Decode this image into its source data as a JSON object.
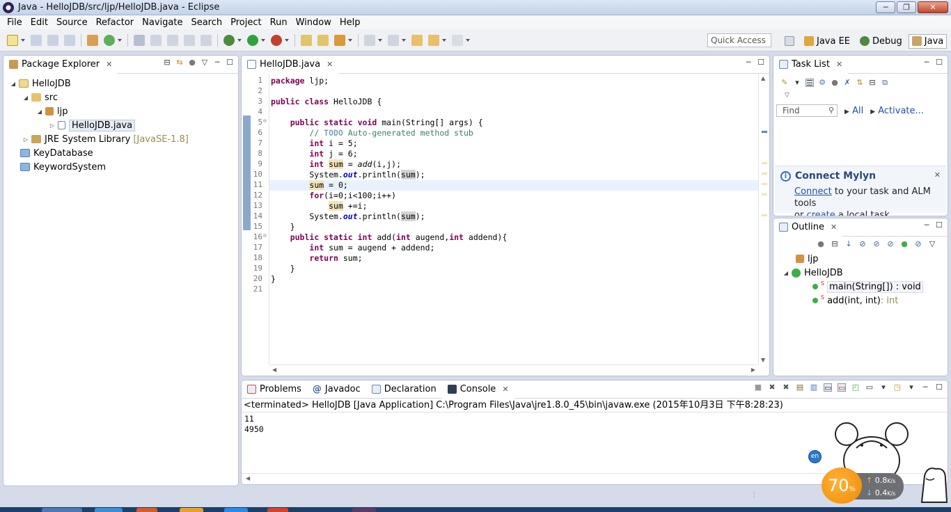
{
  "window": {
    "title": "Java - HelloJDB/src/ljp/HelloJDB.java - Eclipse",
    "min": "0",
    "max": "1",
    "close": "r"
  },
  "menu": [
    "File",
    "Edit",
    "Source",
    "Refactor",
    "Navigate",
    "Search",
    "Project",
    "Run",
    "Window",
    "Help"
  ],
  "toolbar": {
    "quick_access": "Quick Access"
  },
  "perspectives": [
    "Java EE",
    "Debug",
    "Java"
  ],
  "package_explorer": {
    "tab": "Package Explorer",
    "items": [
      {
        "label": "HelloJDB",
        "suffix": ""
      },
      {
        "label": "src",
        "suffix": ""
      },
      {
        "label": "ljp",
        "suffix": ""
      },
      {
        "label": "HelloJDB.java",
        "suffix": ""
      },
      {
        "label": "JRE System Library",
        "suffix": "[JavaSE-1.8]"
      },
      {
        "label": "KeyDatabase",
        "suffix": ""
      },
      {
        "label": "KeywordSystem",
        "suffix": ""
      }
    ]
  },
  "editor": {
    "tab": "HelloJDB.java",
    "line_numbers": [
      "1",
      "2",
      "3",
      "4",
      "5",
      "6",
      "7",
      "8",
      "9",
      "10",
      "11",
      "12",
      "13",
      "14",
      "15",
      "16",
      "17",
      "18",
      "19",
      "20",
      "21"
    ]
  },
  "task_list": {
    "tab": "Task List",
    "find_placeholder": "Find",
    "all": "All",
    "activate": "Activate..."
  },
  "mylyn": {
    "title": "Connect Mylyn",
    "connect": "Connect",
    "text1": " to your task and ALM tools",
    "or": "or ",
    "create": "create",
    "text2": " a local task."
  },
  "outline": {
    "tab": "Outline",
    "package": "ljp",
    "class": "HelloJDB",
    "members": [
      {
        "name": "main(String[])",
        "type": " : void"
      },
      {
        "name": "add(int, int)",
        "type": " : int"
      }
    ]
  },
  "bottom_tabs": [
    "Problems",
    "Javadoc",
    "Declaration",
    "Console"
  ],
  "console": {
    "terminated": "<terminated> HelloJDB [Java Application] C:\\Program Files\\Java\\jre1.8.0_45\\bin\\javaw.exe (2015年10月3日 下午8:28:23)",
    "output": [
      "11",
      "4950"
    ]
  },
  "overlay": {
    "ime": "en",
    "percent": "70",
    "percent_unit": "%",
    "up": "0.8",
    "down": "0.4",
    "speed_unit": "K/s"
  },
  "colors": {
    "keyword": "#7f0055",
    "comment": "#3f7f5f",
    "field": "#0000c0"
  }
}
